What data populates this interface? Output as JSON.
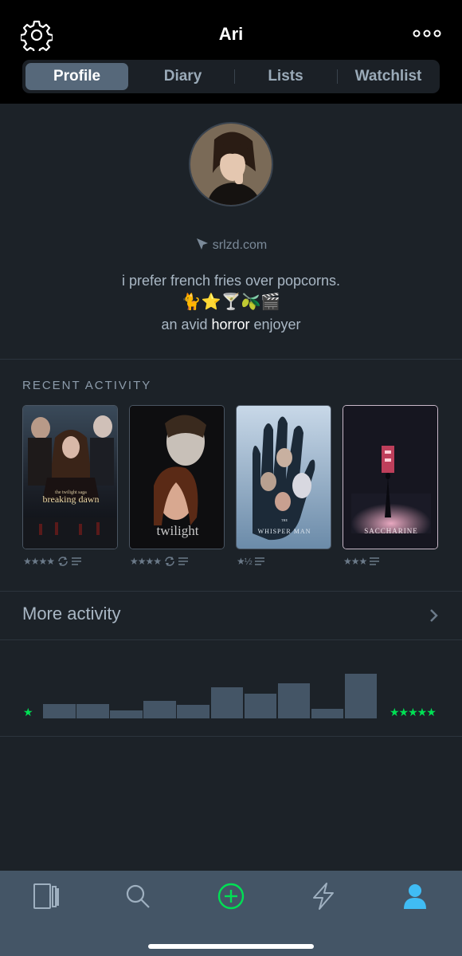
{
  "header": {
    "title": "Ari"
  },
  "tabs": [
    {
      "label": "Profile",
      "active": true
    },
    {
      "label": "Diary",
      "active": false
    },
    {
      "label": "Lists",
      "active": false
    },
    {
      "label": "Watchlist",
      "active": false
    }
  ],
  "profile": {
    "website": "srlzd.com",
    "bio_line1": "i prefer french fries over popcorns.",
    "bio_emojis": "🐈⭐🍸🫒🎬",
    "bio_line3_pre": "an avid ",
    "bio_line3_highlight": "horror",
    "bio_line3_post": " enjoyer"
  },
  "recent_activity": {
    "title": "RECENT ACTIVITY",
    "films": [
      {
        "poster_text": "breaking dawn",
        "poster_subtext": "the twilight saga",
        "rating": "★★★★",
        "rewatch": true,
        "review": true
      },
      {
        "poster_text": "twilight",
        "rating": "★★★★",
        "rewatch": true,
        "review": true
      },
      {
        "poster_text": "WHISPER MAN",
        "poster_subtext": "THE",
        "rating": "★½",
        "rewatch": false,
        "review": true
      },
      {
        "poster_text": "SACCHARINE",
        "rating": "★★★",
        "rewatch": false,
        "review": true
      }
    ]
  },
  "more_activity": {
    "label": "More activity"
  },
  "ratings_histogram": {
    "min_label": "★",
    "max_label": "★★★★★",
    "relative_counts": [
      0.33,
      0.33,
      0.18,
      0.4,
      0.31,
      0.69,
      0.56,
      0.78,
      0.22,
      1.0
    ],
    "bar_color": "#445566",
    "star_color": "#00e054"
  },
  "bottom_nav": [
    {
      "icon": "films-icon",
      "active": false
    },
    {
      "icon": "search-icon",
      "active": false
    },
    {
      "icon": "add-icon",
      "active": false,
      "color": "#00e054"
    },
    {
      "icon": "activity-icon",
      "active": false
    },
    {
      "icon": "profile-icon",
      "active": true,
      "color": "#40bcf4"
    }
  ],
  "colors": {
    "background": "#1c2228",
    "accent_green": "#00e054",
    "accent_blue": "#40bcf4"
  }
}
